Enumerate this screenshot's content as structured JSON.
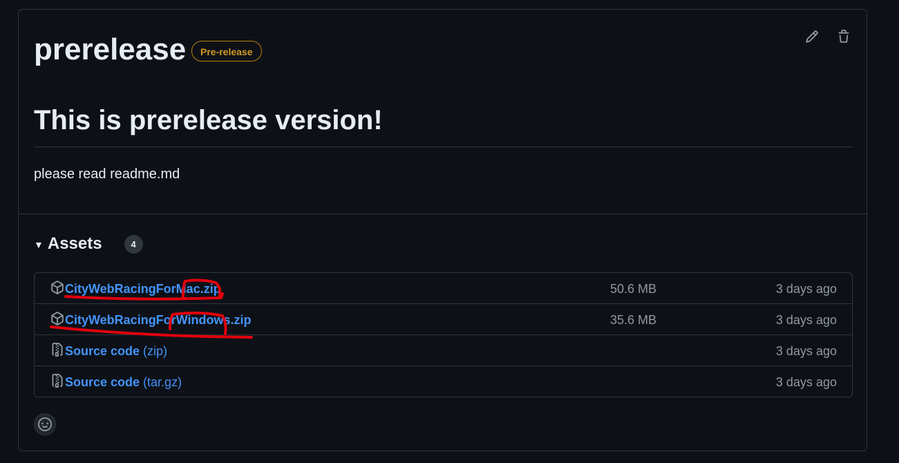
{
  "release": {
    "title": "prerelease",
    "badge": "Pre-release",
    "badge_color": "#d29922"
  },
  "actions": {
    "edit_icon": "pencil-icon",
    "delete_icon": "trash-icon"
  },
  "body": {
    "heading": "This is prerelease version!",
    "text": "please read readme.md"
  },
  "assets": {
    "label": "Assets",
    "count": "4",
    "items": [
      {
        "icon": "package-icon",
        "name": "CityWebRacingForMac.zip",
        "suffix": "",
        "size": "50.6 MB",
        "date": "3 days ago"
      },
      {
        "icon": "package-icon",
        "name": "CityWebRacingForWindows.zip",
        "suffix": "",
        "size": "35.6 MB",
        "date": "3 days ago"
      },
      {
        "icon": "file-zip-icon",
        "name": "Source code",
        "suffix": "(zip)",
        "size": "",
        "date": "3 days ago"
      },
      {
        "icon": "file-zip-icon",
        "name": "Source code",
        "suffix": "(tar.gz)",
        "size": "",
        "date": "3 days ago"
      }
    ]
  },
  "reaction": {
    "icon": "smiley-icon"
  },
  "colors": {
    "background": "#0d1117",
    "border": "#30363d",
    "link": "#4493f8",
    "muted": "#9198a1",
    "annotation_red": "#e0000d"
  }
}
